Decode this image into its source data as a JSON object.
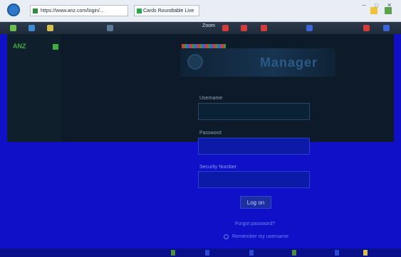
{
  "browser": {
    "address": "https://www.anz.com/login/...",
    "tab_title": "Cards Roundtable Live",
    "window_controls": "─ □ ✕"
  },
  "toolbar": {
    "title": "Zoom"
  },
  "sidebar": {
    "brand": "ANZ"
  },
  "login": {
    "app_name": "Manager",
    "username_label": "Username",
    "username_value": "",
    "password_label": "Password",
    "password_value": "",
    "pin_label": "Security Number",
    "pin_value": "",
    "signin_label": "Log on",
    "forgot_link": "Forgot password?",
    "remember_label": "Remember my username"
  },
  "colors": {
    "page_bg": "#1010c8",
    "panel_bg": "#0c1a2a",
    "accent_green": "#3fae3f",
    "title_blue": "#2a5a86"
  }
}
